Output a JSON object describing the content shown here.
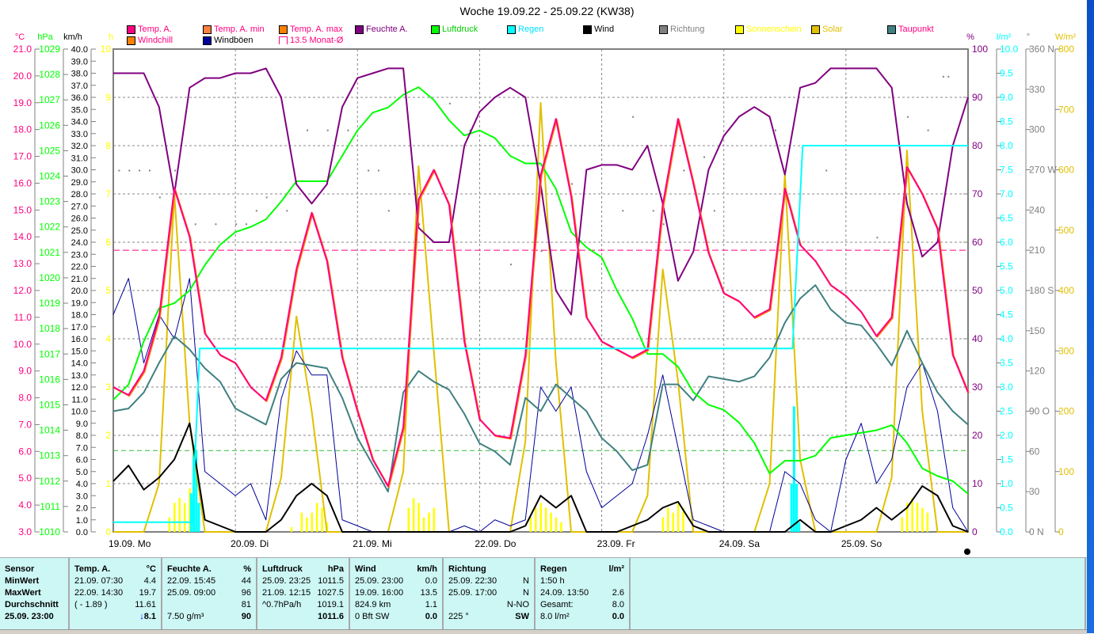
{
  "title": "Woche 19.09.22 - 25.09.22 (KW38)",
  "legend": [
    {
      "label": "Temp. A.",
      "color": "#ff0080",
      "text": "#ff0080",
      "box": "#ff0080",
      "row": 0,
      "col": 0
    },
    {
      "label": "Temp. A. min",
      "color": "#ff8040",
      "text": "#ff0080",
      "row": 0,
      "col": 1
    },
    {
      "label": "Temp. A. max",
      "color": "#ff8000",
      "text": "#ff0080",
      "row": 0,
      "col": 2
    },
    {
      "label": "Feuchte A.",
      "color": "#800080",
      "text": "#800080",
      "row": 0,
      "col": 3
    },
    {
      "label": "Luftdruck",
      "color": "#00ff00",
      "text": "#00cc00",
      "row": 0,
      "col": 4
    },
    {
      "label": "Regen",
      "color": "#00ffff",
      "text": "#00e0ff",
      "row": 0,
      "col": 5
    },
    {
      "label": "Wind",
      "color": "#000000",
      "text": "#000000",
      "row": 0,
      "col": 6
    },
    {
      "label": "Richtung",
      "color": "#808080",
      "text": "#808080",
      "row": 0,
      "col": 7
    },
    {
      "label": "Sonnenschein",
      "color": "#ffff00",
      "text": "#ffff00",
      "row": 0,
      "col": 8
    },
    {
      "label": "Solar",
      "color": "#e0c000",
      "text": "#e0c000",
      "row": 0,
      "col": 9
    },
    {
      "label": "Taupunkt",
      "color": "#408080",
      "text": "#ff0080",
      "row": 0,
      "col": 10
    },
    {
      "label": "Windchill",
      "color": "#ff8000",
      "text": "#ff0080",
      "row": 1,
      "col": 0
    },
    {
      "label": "Windböen",
      "color": "#000099",
      "text": "#000000",
      "row": 1,
      "col": 1
    },
    {
      "label": "13.5 Monat-Ø",
      "color": "#ffffff",
      "text": "#ff0080",
      "row": 1,
      "col": 2
    }
  ],
  "chart_data": {
    "type": "line",
    "title": "Woche 19.09.22 - 25.09.22 (KW38)",
    "x_unit": "hours since 19.09. 00:00",
    "x_range": [
      0,
      168
    ],
    "step_hours": 3,
    "day_labels": [
      "19.09.  Mo",
      "20.09.  Di",
      "21.09.  Mi",
      "22.09.  Do",
      "23.09.  Fr",
      "24.09.  Sa",
      "25.09.  So"
    ],
    "axes": {
      "temp": {
        "unit": "°C",
        "min": 3,
        "max": 21,
        "step": 1,
        "dec": 1,
        "color": "#ff0080"
      },
      "pressure": {
        "unit": "hPa",
        "min": 1010,
        "max": 1029,
        "step": 1,
        "dec": 0,
        "color": "#00ff00"
      },
      "wind": {
        "unit": "km/h",
        "min": 0,
        "max": 40,
        "step": 1,
        "dec": 1,
        "color": "#000000"
      },
      "sun": {
        "unit": "h",
        "min": 0,
        "max": 10,
        "step": 1,
        "dec": 0,
        "color": "#ffff00"
      },
      "humidity": {
        "unit": "%",
        "min": 0,
        "max": 100,
        "step": 10,
        "dec": 0,
        "color": "#800080"
      },
      "rain": {
        "unit": "l/m²",
        "min": 0,
        "max": 10,
        "step": 0.5,
        "dec": 1,
        "color": "#00ffff"
      },
      "direction": {
        "unit": "°",
        "min": 0,
        "max": 360,
        "step": 30,
        "dec": 0,
        "color": "#808080",
        "compass": {
          "0": "N",
          "90": "O",
          "180": "S",
          "270": "W",
          "360": "N"
        }
      },
      "solar": {
        "unit": "W/m²",
        "min": 0,
        "max": 800,
        "step": 100,
        "dec": 0,
        "color": "#e0c000"
      }
    },
    "month_avg_temp": 13.5,
    "pressure_ref_line": 1013.2,
    "series": [
      {
        "name": "Temp. A.",
        "axis": "temp",
        "color": "#ff0080",
        "values": [
          8.4,
          8.1,
          9.0,
          11.0,
          15.8,
          14.0,
          10.4,
          9.6,
          9.3,
          8.4,
          7.9,
          9.5,
          12.8,
          14.9,
          13.1,
          9.5,
          7.5,
          5.7,
          4.7,
          6.9,
          15.4,
          16.5,
          15.2,
          10.1,
          7.2,
          6.6,
          6.5,
          9.6,
          16.3,
          18.4,
          15.5,
          11.0,
          10.1,
          9.8,
          9.5,
          9.8,
          15.2,
          18.4,
          16.0,
          13.4,
          11.9,
          11.6,
          11.0,
          11.3,
          15.8,
          13.7,
          13.1,
          12.2,
          11.8,
          11.2,
          10.3,
          11.0,
          16.6,
          15.6,
          14.3,
          9.6,
          8.2
        ]
      },
      {
        "name": "Feuchte A.",
        "axis": "humidity",
        "color": "#800080",
        "values": [
          95,
          95,
          95,
          88,
          70,
          92,
          94,
          94,
          95,
          95,
          96,
          90,
          72,
          68,
          72,
          88,
          94,
          95,
          96,
          96,
          63,
          60,
          60,
          80,
          87,
          90,
          92,
          90,
          72,
          50,
          45,
          75,
          76,
          76,
          75,
          80,
          68,
          52,
          58,
          75,
          82,
          86,
          88,
          86,
          74,
          92,
          93,
          96,
          96,
          96,
          96,
          92,
          68,
          57,
          60,
          80,
          90
        ]
      },
      {
        "name": "Luftdruck",
        "axis": "pressure",
        "color": "#00ff00",
        "values": [
          1015.2,
          1015.8,
          1017.5,
          1018.8,
          1019.0,
          1019.5,
          1020.5,
          1021.3,
          1021.8,
          1022.0,
          1022.3,
          1023.0,
          1023.8,
          1023.8,
          1023.8,
          1024.8,
          1025.8,
          1026.5,
          1026.7,
          1027.2,
          1027.5,
          1027.0,
          1026.2,
          1025.6,
          1025.8,
          1025.5,
          1024.8,
          1024.5,
          1024.5,
          1023.5,
          1021.8,
          1021.2,
          1020.8,
          1019.5,
          1018.4,
          1017.0,
          1017.0,
          1016.5,
          1015.5,
          1015.0,
          1014.8,
          1014.3,
          1013.5,
          1012.3,
          1012.8,
          1012.8,
          1013.0,
          1013.7,
          1013.8,
          1013.9,
          1014.0,
          1014.2,
          1013.5,
          1012.5,
          1012.2,
          1012.0,
          1011.5
        ]
      },
      {
        "name": "Taupunkt",
        "axis": "temp",
        "color": "#408080",
        "values": [
          7.5,
          7.6,
          8.2,
          9.3,
          10.3,
          9.8,
          9.1,
          8.6,
          7.6,
          7.3,
          7.0,
          8.7,
          9.3,
          9.2,
          9.1,
          8.0,
          6.5,
          5.5,
          4.5,
          8.2,
          9.0,
          8.6,
          8.3,
          7.4,
          6.3,
          6.0,
          5.5,
          8.0,
          7.5,
          8.5,
          8.0,
          7.5,
          6.5,
          6.0,
          5.3,
          5.5,
          8.5,
          8.5,
          7.9,
          8.8,
          8.7,
          8.6,
          8.8,
          9.5,
          10.8,
          11.7,
          12.2,
          11.3,
          10.8,
          10.7,
          10.0,
          9.2,
          10.5,
          9.3,
          8.2,
          7.5,
          7.0
        ]
      },
      {
        "name": "Windböen",
        "axis": "wind",
        "color": "#000099",
        "values": [
          18,
          21,
          14,
          18,
          16,
          21,
          5,
          4,
          3,
          4,
          1,
          11,
          15,
          13,
          13,
          1,
          0.5,
          0,
          0,
          0,
          0,
          0,
          0,
          0.5,
          0,
          1,
          0.5,
          1,
          12,
          10,
          12,
          5,
          2,
          3,
          4,
          8,
          13,
          7,
          1,
          0.5,
          0,
          0,
          0,
          0,
          5,
          4,
          1,
          0,
          6,
          9,
          4,
          6,
          12,
          14,
          10,
          2,
          0
        ]
      },
      {
        "name": "Wind",
        "axis": "wind",
        "color": "#000000",
        "values": [
          4.2,
          5.5,
          3.5,
          4.5,
          6,
          9,
          1,
          0.5,
          0,
          0,
          0,
          1,
          3,
          4,
          3,
          0,
          0,
          0,
          0,
          0,
          0,
          0,
          0,
          0,
          0,
          0,
          0,
          0.5,
          3,
          2,
          3,
          0,
          0,
          0,
          0.5,
          1,
          2,
          2.5,
          0.5,
          0,
          0,
          0,
          0,
          0,
          0,
          1,
          0,
          0,
          0.5,
          1,
          2,
          1,
          2,
          3.8,
          3,
          0.5,
          0
        ]
      },
      {
        "name": "Solar",
        "axis": "solar",
        "color": "#e0c000",
        "values": [
          0,
          0,
          0,
          80,
          560,
          180,
          0,
          0,
          0,
          0,
          0,
          90,
          357,
          200,
          0,
          0,
          0,
          0,
          0,
          100,
          606,
          300,
          0,
          0,
          0,
          0,
          0,
          150,
          711,
          280,
          0,
          0,
          0,
          0,
          0,
          60,
          435,
          250,
          0,
          0,
          0,
          0,
          0,
          80,
          593,
          120,
          0,
          0,
          0,
          0,
          0,
          90,
          632,
          200,
          0,
          0,
          0
        ]
      }
    ],
    "rain_total": {
      "name": "Regen",
      "axis": "rain",
      "points": [
        [
          0,
          0.2
        ],
        [
          15.5,
          0.2
        ],
        [
          17,
          3.8
        ],
        [
          133.5,
          3.8
        ],
        [
          135.5,
          8.0
        ],
        [
          168,
          8.0
        ]
      ]
    },
    "rain_bars": {
      "axis": "rain",
      "points": [
        [
          15.3,
          0.8
        ],
        [
          15.8,
          1.8
        ],
        [
          16.3,
          1.7
        ],
        [
          16.8,
          0.6
        ],
        [
          133.3,
          1.0
        ],
        [
          133.8,
          2.6
        ],
        [
          134.3,
          1.0
        ],
        [
          134.8,
          0.2
        ]
      ]
    },
    "sunshine_bars": {
      "axis": "sun",
      "points": [
        [
          11,
          0.3
        ],
        [
          12,
          0.6
        ],
        [
          13,
          0.7
        ],
        [
          14,
          0.6
        ],
        [
          15,
          0.9
        ],
        [
          35,
          0.1
        ],
        [
          37,
          0.4
        ],
        [
          38,
          0.3
        ],
        [
          39,
          0.4
        ],
        [
          40,
          0.6
        ],
        [
          41,
          0.5
        ],
        [
          42,
          0.2
        ],
        [
          58,
          0.5
        ],
        [
          59,
          0.7
        ],
        [
          60,
          0.6
        ],
        [
          61,
          0.3
        ],
        [
          62,
          0.4
        ],
        [
          63,
          0.5
        ],
        [
          82,
          0.3
        ],
        [
          83,
          0.5
        ],
        [
          84,
          0.6
        ],
        [
          85,
          0.5
        ],
        [
          86,
          0.4
        ],
        [
          87,
          0.3
        ],
        [
          88,
          0.2
        ],
        [
          108,
          0.3
        ],
        [
          109,
          0.5
        ],
        [
          110,
          0.4
        ],
        [
          111,
          0.6
        ],
        [
          112,
          0.5
        ],
        [
          155,
          0.3
        ],
        [
          156,
          0.6
        ],
        [
          157,
          0.7
        ],
        [
          158,
          0.6
        ],
        [
          159,
          0.5
        ],
        [
          160,
          0.4
        ]
      ]
    },
    "direction_points": {
      "axis": "direction",
      "points": [
        [
          1,
          270
        ],
        [
          3,
          270
        ],
        [
          5,
          270
        ],
        [
          7,
          270
        ],
        [
          9,
          250
        ],
        [
          12,
          270
        ],
        [
          16,
          230
        ],
        [
          20,
          230
        ],
        [
          24,
          230
        ],
        [
          26,
          230
        ],
        [
          28,
          240
        ],
        [
          30,
          250
        ],
        [
          34,
          240
        ],
        [
          38,
          300
        ],
        [
          42,
          300
        ],
        [
          46,
          300
        ],
        [
          50,
          270
        ],
        [
          52,
          270
        ],
        [
          54,
          240
        ],
        [
          60,
          230
        ],
        [
          66,
          320
        ],
        [
          70,
          300
        ],
        [
          78,
          200
        ],
        [
          84,
          210
        ],
        [
          90,
          260
        ],
        [
          100,
          240
        ],
        [
          102,
          310
        ],
        [
          106,
          240
        ],
        [
          108,
          230
        ],
        [
          112,
          270
        ],
        [
          116,
          280
        ],
        [
          118,
          240
        ],
        [
          130,
          300
        ],
        [
          140,
          270
        ],
        [
          150,
          220
        ],
        [
          156,
          310
        ],
        [
          160,
          300
        ],
        [
          163,
          340
        ],
        [
          164,
          340
        ]
      ]
    }
  },
  "table": {
    "columns": [
      {
        "head": "Sensor",
        "unit": "",
        "rows": [
          [
            "MinWert",
            ""
          ],
          [
            "MaxWert",
            ""
          ],
          [
            "Durchschnitt",
            ""
          ],
          [
            "25.09. 23:00",
            ""
          ]
        ],
        "boldrows": true
      },
      {
        "head": "Temp. A.",
        "unit": "°C",
        "rows": [
          [
            "21.09.  07:30",
            "4.4"
          ],
          [
            "22.09.  14:30",
            "19.7"
          ],
          [
            "( - 1.89 )",
            "11.61"
          ],
          [
            "",
            "8.1"
          ]
        ],
        "arrow": "↓"
      },
      {
        "head": "Feuchte A.",
        "unit": "%",
        "rows": [
          [
            "22.09.  15:45",
            "44"
          ],
          [
            "25.09.  09:00",
            "96"
          ],
          [
            "",
            "81"
          ],
          [
            "7.50 g/m³",
            "90"
          ]
        ]
      },
      {
        "head": "Luftdruck",
        "unit": "hPa",
        "rows": [
          [
            "25.09.  23:25",
            "1011.5"
          ],
          [
            "21.09.  12:15",
            "1027.5"
          ],
          [
            "^0.7hPa/h",
            "1019.1"
          ],
          [
            "",
            "1011.6"
          ]
        ]
      },
      {
        "head": "Wind",
        "unit": "km/h",
        "rows": [
          [
            "25.09.  23:00",
            "0.0"
          ],
          [
            "19.09.  16:00",
            "13.5"
          ],
          [
            "824.9 km",
            "1.1"
          ],
          [
            "0 Bft SW",
            "0.0"
          ]
        ]
      },
      {
        "head": "Richtung",
        "unit": "",
        "rows": [
          [
            "25.09.  22:30",
            "N"
          ],
          [
            "25.09.  17:00",
            "N"
          ],
          [
            "",
            "N-NO"
          ],
          [
            "225 °",
            "SW"
          ]
        ]
      },
      {
        "head": "Regen",
        "unit": "l/m²",
        "rows": [
          [
            "1:50 h",
            ""
          ],
          [
            "24.09.  13:50",
            "2.6"
          ],
          [
            "Gesamt:",
            "8.0"
          ],
          [
            "8.0 l/m²",
            "0.0"
          ]
        ]
      }
    ]
  }
}
